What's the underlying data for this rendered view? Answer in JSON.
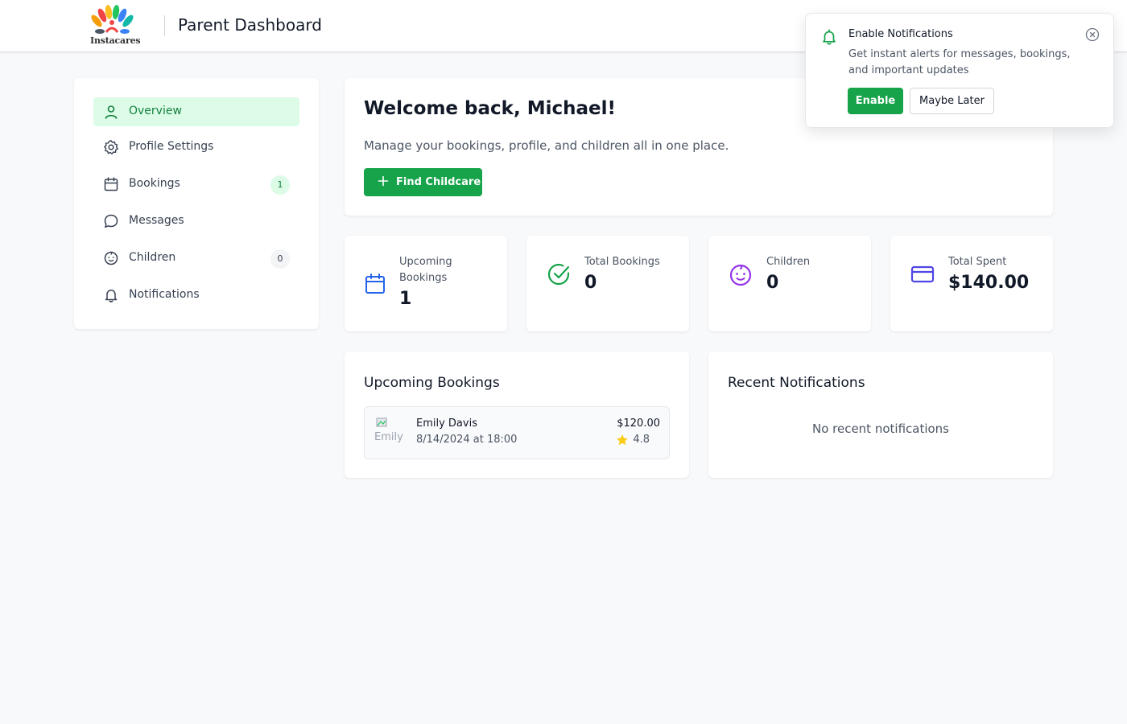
{
  "header": {
    "logo_text": "Instacares",
    "title": "Parent Dashboard"
  },
  "sidebar": {
    "items": [
      {
        "label": "Overview",
        "icon": "user-icon",
        "active": true
      },
      {
        "label": "Profile Settings",
        "icon": "gear-icon"
      },
      {
        "label": "Bookings",
        "icon": "calendar-icon",
        "badge": "1"
      },
      {
        "label": "Messages",
        "icon": "chat-bubble-icon"
      },
      {
        "label": "Children",
        "icon": "baby-face-icon",
        "badge": "0"
      },
      {
        "label": "Notifications",
        "icon": "bell-icon"
      }
    ]
  },
  "welcome": {
    "title": "Welcome back, Michael!",
    "subtitle": "Manage your bookings, profile, and children all in one place.",
    "button_label": "Find Childcare"
  },
  "stats": [
    {
      "label_line1": "Upcoming",
      "label_line2": "Bookings",
      "value": "1",
      "icon": "calendar-icon",
      "color": "#2563eb"
    },
    {
      "label": "Total Bookings",
      "value": "0",
      "icon": "check-circle-icon",
      "color": "#16a34a"
    },
    {
      "label": "Children",
      "value": "0",
      "icon": "baby-face-icon",
      "color": "#9333ea"
    },
    {
      "label": "Total Spent",
      "value": "$140.00",
      "icon": "credit-card-icon",
      "color": "#4f46e5"
    }
  ],
  "upcoming": {
    "title": "Upcoming Bookings",
    "bookings": [
      {
        "avatar_alt": "Emily",
        "name": "Emily Davis",
        "date": "8/14/2024 at 18:00",
        "price": "$120.00",
        "rating": "4.8"
      }
    ]
  },
  "recent": {
    "title": "Recent Notifications",
    "empty": "No recent notifications"
  },
  "popup": {
    "title": "Enable Notifications",
    "description": "Get instant alerts for messages, bookings, and important updates",
    "enable_label": "Enable",
    "later_label": "Maybe Later"
  },
  "colors": {
    "brand_green": "#16a34a",
    "active_bg": "#dcfce7"
  }
}
